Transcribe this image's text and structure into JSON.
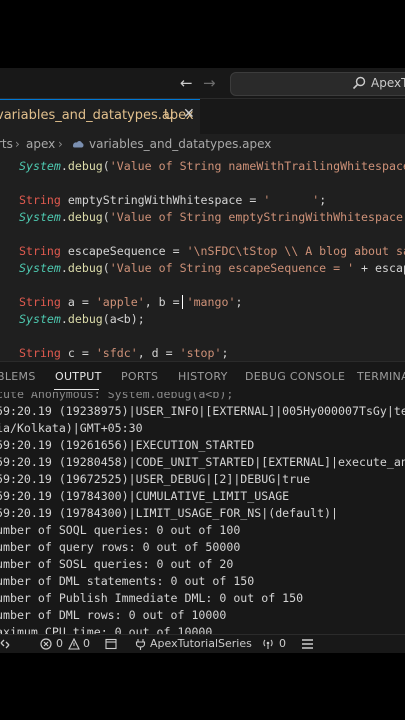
{
  "window": {
    "search_text": "ApexTutorialSeries"
  },
  "tab": {
    "name": "variables_and_datatypes.apex",
    "status": "U",
    "close_glyph": "✕"
  },
  "breadcrumb": {
    "items": [
      "rts",
      "apex",
      "variables_and_datatypes.apex"
    ]
  },
  "editor": {
    "lines": [
      {
        "tokens": [
          [
            "cls",
            "System"
          ],
          [
            "def",
            "."
          ],
          [
            "fn",
            "debug"
          ],
          [
            "def",
            "("
          ],
          [
            "str",
            "'Value of String nameWithTrailingWhitespace"
          ]
        ]
      },
      {
        "tokens": []
      },
      {
        "tokens": [
          [
            "kw",
            "String"
          ],
          [
            "def",
            " "
          ],
          [
            "id",
            "emptyStringWithWhitespace"
          ],
          [
            "def",
            " = "
          ],
          [
            "str",
            "'      '"
          ],
          [
            "def",
            ";"
          ]
        ]
      },
      {
        "tokens": [
          [
            "cls",
            "System"
          ],
          [
            "def",
            "."
          ],
          [
            "fn",
            "debug"
          ],
          [
            "def",
            "("
          ],
          [
            "str",
            "'Value of String emptyStringWithWhitespace ="
          ]
        ]
      },
      {
        "tokens": []
      },
      {
        "tokens": [
          [
            "kw",
            "String"
          ],
          [
            "def",
            " "
          ],
          [
            "id",
            "escapeSequence"
          ],
          [
            "def",
            " = "
          ],
          [
            "str",
            "'\\nSFDC\\tStop \\\\ A blog about sal"
          ]
        ]
      },
      {
        "tokens": [
          [
            "cls",
            "System"
          ],
          [
            "def",
            "."
          ],
          [
            "fn",
            "debug"
          ],
          [
            "def",
            "("
          ],
          [
            "str",
            "'Value of String escapeSequence = '"
          ],
          [
            "def",
            " + escape"
          ]
        ]
      },
      {
        "tokens": []
      },
      {
        "tokens": [
          [
            "kw",
            "String"
          ],
          [
            "def",
            " "
          ],
          [
            "id",
            "a"
          ],
          [
            "def",
            " = "
          ],
          [
            "str",
            "'apple'"
          ],
          [
            "def",
            ", "
          ],
          [
            "id",
            "b"
          ],
          [
            "def",
            " = "
          ],
          [
            "str",
            "'mango'"
          ],
          [
            "def",
            ";"
          ]
        ]
      },
      {
        "tokens": [
          [
            "cls",
            "System"
          ],
          [
            "def",
            "."
          ],
          [
            "fn",
            "debug"
          ],
          [
            "def",
            "("
          ],
          [
            "id",
            "a"
          ],
          [
            "def",
            "<"
          ],
          [
            "id",
            "b"
          ],
          [
            "def",
            ");"
          ]
        ]
      },
      {
        "tokens": []
      },
      {
        "tokens": [
          [
            "kw",
            "String"
          ],
          [
            "def",
            " "
          ],
          [
            "id",
            "c"
          ],
          [
            "def",
            " = "
          ],
          [
            "str",
            "'sfdc'"
          ],
          [
            "def",
            ", "
          ],
          [
            "id",
            "d"
          ],
          [
            "def",
            " = "
          ],
          [
            "str",
            "'stop'"
          ],
          [
            "def",
            ";"
          ]
        ]
      }
    ]
  },
  "panel": {
    "tabs": [
      "BLEMS",
      "OUTPUT",
      "PORTS",
      "HISTORY",
      "DEBUG CONSOLE",
      "TERMINAL"
    ],
    "active_tab": "OUTPUT",
    "output_lines": [
      "cute Anonymous: System.debug(a<b);",
      "59:20.19 (19238975)|USER_INFO|[EXTERNAL]|005Hy000007TsGy|test",
      "ia/Kolkata)|GMT+05:30",
      "59:20.19 (19261656)|EXECUTION_STARTED",
      "59:20.19 (19280458)|CODE_UNIT_STARTED|[EXTERNAL]|execute_anon",
      "59:20.19 (19672525)|USER_DEBUG|[2]|DEBUG|true",
      "59:20.19 (19784300)|CUMULATIVE_LIMIT_USAGE",
      "59:20.19 (19784300)|LIMIT_USAGE_FOR_NS|(default)|",
      "umber of SOQL queries: 0 out of 100",
      "umber of query rows: 0 out of 50000",
      "umber of SOSL queries: 0 out of 20",
      "umber of DML statements: 0 out of 150",
      "umber of Publish Immediate DML: 0 out of 150",
      "umber of DML rows: 0 out of 10000",
      "aximum CPU time: 0 out of 10000"
    ]
  },
  "statusbar": {
    "errors": "0",
    "warnings": "0",
    "org": "ApexTutorialSeries",
    "ports": "0"
  },
  "colors": {
    "accent": "#0078d4",
    "modified": "#e2c08d",
    "keyword": "#e05a4f",
    "class": "#4ec9b0",
    "string": "#ce9178"
  }
}
